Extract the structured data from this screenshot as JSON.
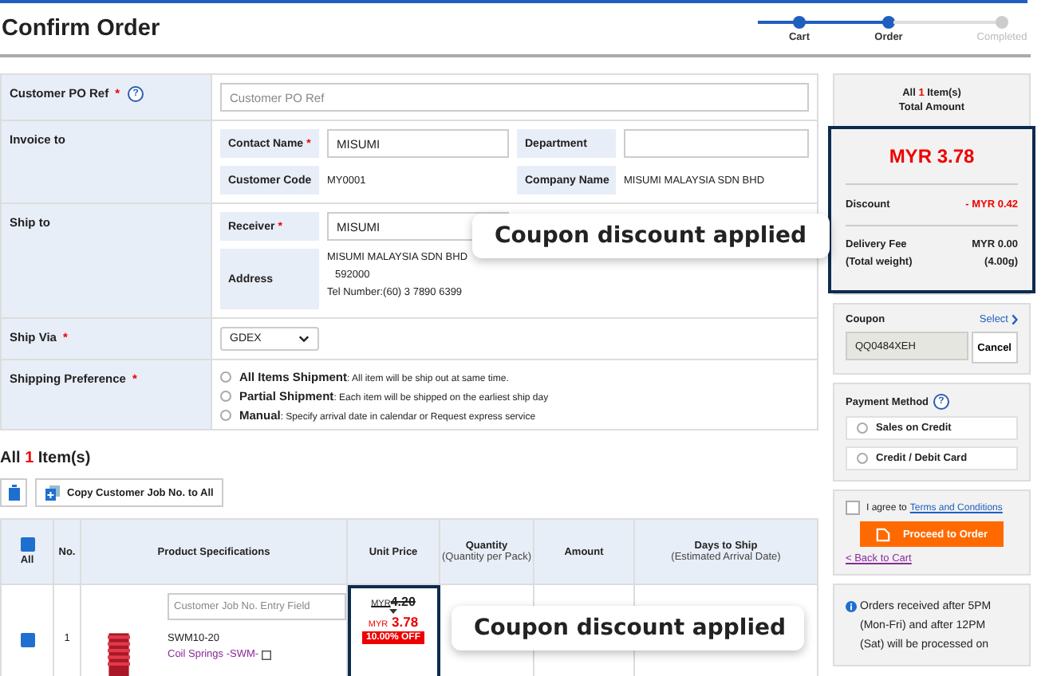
{
  "title": "Confirm Order",
  "steps": [
    {
      "label": "Cart",
      "done": true
    },
    {
      "label": "Order",
      "done": true
    },
    {
      "label": "Completed",
      "done": false
    }
  ],
  "form": {
    "po_ref": {
      "label": "Customer PO Ref",
      "required_mark": "*",
      "help": "?",
      "placeholder": "Customer PO Ref"
    },
    "invoice_to": {
      "label": "Invoice to",
      "contact_label": "Contact Name",
      "contact_mark": "*",
      "contact_value": "MISUMI",
      "department_label": "Department",
      "code_label": "Customer Code",
      "code_value": "MY0001",
      "company_label": "Company Name",
      "company_value": "MISUMI MALAYSIA SDN BHD"
    },
    "ship_to": {
      "label": "Ship to",
      "receiver_label": "Receiver",
      "receiver_mark": "*",
      "receiver_value": "MISUMI",
      "address_label": "Address",
      "address_lines": [
        "MISUMI MALAYSIA SDN BHD",
        "592000",
        "Tel Number:(60) 3 7890 6399"
      ]
    },
    "ship_via": {
      "label": "Ship Via",
      "required_mark": "*",
      "value": "GDEX"
    },
    "shipping_preference": {
      "label": "Shipping Preference",
      "required_mark": "*",
      "options": [
        {
          "title": "All Items Shipment",
          "description": ": All item will be ship out at same time.",
          "selected": false
        },
        {
          "title": "Partial Shipment",
          "description": ": Each item will be shipped on the earliest ship day",
          "selected": false
        },
        {
          "title": "Manual",
          "description": ": Specify arrival date in calendar or Request express service",
          "selected": false
        }
      ]
    }
  },
  "items": {
    "prefix": "All",
    "count": "1",
    "suffix": "Item(s)",
    "copy_button": "Copy Customer Job No. to All",
    "columns": [
      {
        "label": "All",
        "checked": true
      },
      {
        "label": "No."
      },
      {
        "label": "Product Specifications"
      },
      {
        "label": "Unit Price"
      },
      {
        "label": "Quantity",
        "sub": "(Quantity per Pack)"
      },
      {
        "label": "Amount"
      },
      {
        "label": "Days to Ship",
        "sub": "(Estimated Arrival Date)"
      }
    ],
    "rows": [
      {
        "checked": true,
        "no": "1",
        "job_placeholder": "Customer Job No. Entry Field",
        "part": "SWM10-20",
        "name": "Coil Springs -SWM-",
        "old_currency": "MYR",
        "old_price": "4.20",
        "new_currency": "MYR",
        "new_price": "3.78",
        "discount_badge": "10.00% OFF"
      }
    ]
  },
  "summary": {
    "prefix": "All",
    "count": "1",
    "suffix": "Item(s)",
    "total_label": "Total Amount",
    "total": "MYR 3.78",
    "discount_label": "Discount",
    "discount": "- MYR 0.42",
    "delivery_label": "Delivery Fee",
    "delivery": "MYR 0.00",
    "weight_label": "(Total weight)",
    "weight": "(4.00g)"
  },
  "coupon": {
    "label": "Coupon",
    "select": "Select",
    "code": "QQ0484XEH",
    "cancel": "Cancel"
  },
  "payment": {
    "label": "Payment Method",
    "help": "?",
    "options": [
      {
        "label": "Sales on Credit",
        "selected": false
      },
      {
        "label": "Credit / Debit Card",
        "selected": false
      }
    ]
  },
  "agree": {
    "checked": false,
    "text": "I agree to",
    "link": "Terms and Conditions",
    "button": "Proceed to Order",
    "back": "< Back to Cart"
  },
  "notice": {
    "lines": [
      "Orders received after 5PM",
      "(Mon-Fri) and after 12PM",
      "(Sat) will be processed on"
    ]
  },
  "callouts": [
    {
      "text": "Coupon discount applied"
    },
    {
      "text": "Coupon discount applied"
    }
  ]
}
